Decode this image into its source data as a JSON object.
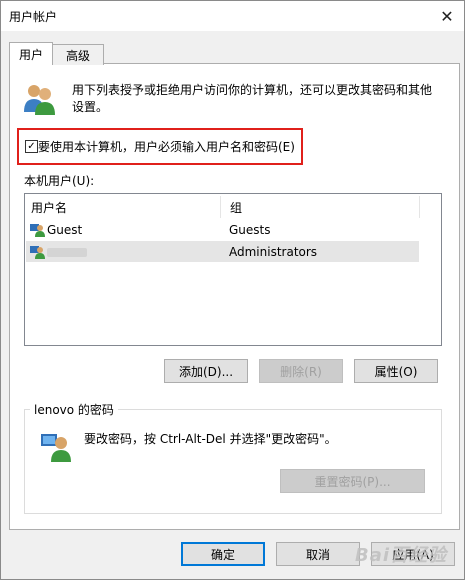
{
  "window": {
    "title": "用户帐户",
    "close_glyph": "✕"
  },
  "tabs": [
    {
      "label": "用户"
    },
    {
      "label": "高级"
    }
  ],
  "intro": {
    "text": "用下列表授予或拒绝用户访问你的计算机，还可以更改其密码和其他设置。"
  },
  "require_login": {
    "label": "要使用本计算机，用户必须输入用户名和密码(E)",
    "checked": true,
    "check_glyph": "✓"
  },
  "users": {
    "label": "本机用户(U):",
    "columns": {
      "name": "用户名",
      "group": "组"
    },
    "rows": [
      {
        "name": "Guest",
        "group": "Guests"
      },
      {
        "name": "",
        "group": "Administrators",
        "name_redacted": true
      }
    ]
  },
  "buttons": {
    "add": "添加(D)...",
    "remove": "删除(R)",
    "properties": "属性(O)",
    "reset_password": "重置密码(P)...",
    "ok": "确定",
    "cancel": "取消",
    "apply": "应用(A)"
  },
  "password_group": {
    "title": "lenovo 的密码",
    "text": "要改密码，按 Ctrl-Alt-Del 并选择\"更改密码\"。"
  },
  "watermark": {
    "text": "Bai百经验"
  },
  "colors": {
    "highlight_border": "#e0201b",
    "accent": "#0078d7",
    "selected_row": "#e5e5e5"
  },
  "icons": {
    "users": "users-icon",
    "user": "user-icon",
    "password": "password-icon"
  }
}
